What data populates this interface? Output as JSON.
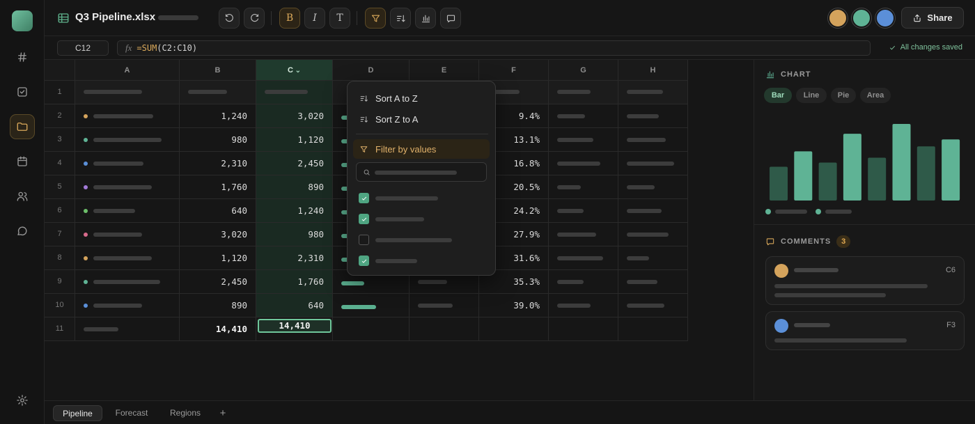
{
  "app": {
    "file_name": "Q3 Pipeline.xlsx",
    "collaborators": [
      {
        "color": "#d4a35c"
      },
      {
        "color": "#5fb395"
      },
      {
        "color": "#5b8fd8"
      }
    ],
    "share_label": "Share",
    "save_status": "All changes saved"
  },
  "formula_bar": {
    "cell_ref": "C12",
    "fx_label": "fx",
    "formula_fn": "=SUM",
    "formula_args": "(C2:C10)"
  },
  "sheet": {
    "columns": [
      "A",
      "B",
      "C",
      "D",
      "E",
      "F",
      "G",
      "H"
    ],
    "selected_column": "C",
    "row_numbers": [
      "1",
      "2",
      "3",
      "4",
      "5",
      "6",
      "7",
      "8",
      "9",
      "10",
      "11"
    ],
    "rows": [
      {
        "dot": "#d4a35c",
        "b": "1,240",
        "c": "3,020",
        "f": "9.4%"
      },
      {
        "dot": "#5fb395",
        "b": "980",
        "c": "1,120",
        "f": "13.1%"
      },
      {
        "dot": "#5b8fd8",
        "b": "2,310",
        "c": "2,450",
        "f": "16.8%"
      },
      {
        "dot": "#a27ad8",
        "b": "1,760",
        "c": "890",
        "f": "20.5%"
      },
      {
        "dot": "#6cbf6a",
        "b": "640",
        "c": "1,240",
        "f": "24.2%"
      },
      {
        "dot": "#d86a8c",
        "b": "3,020",
        "c": "980",
        "f": "27.9%"
      },
      {
        "dot": "#d4a35c",
        "b": "1,120",
        "c": "2,310",
        "f": "31.6%"
      },
      {
        "dot": "#5fb395",
        "b": "2,450",
        "c": "1,760",
        "f": "35.3%"
      },
      {
        "dot": "#5b8fd8",
        "b": "890",
        "c": "640",
        "f": "39.0%"
      }
    ],
    "total_b": "14,410",
    "total_c": "14,410"
  },
  "filter_menu": {
    "sort_az": "Sort A to Z",
    "sort_za": "Sort Z to A",
    "filter_by_values": "Filter by values",
    "options": [
      {
        "checked": true
      },
      {
        "checked": true
      },
      {
        "checked": false
      },
      {
        "checked": true
      }
    ]
  },
  "chart_panel": {
    "title": "CHART",
    "types": [
      "Bar",
      "Line",
      "Pie",
      "Area"
    ],
    "active_type": "Bar",
    "chart_data": {
      "type": "bar",
      "values": [
        48,
        70,
        54,
        95,
        61,
        109,
        77,
        87
      ],
      "colors": [
        "#2f5a49",
        "#5fb395",
        "#2f5a49",
        "#5fb395",
        "#2f5a49",
        "#5fb395",
        "#2f5a49",
        "#5fb395"
      ]
    }
  },
  "comments_panel": {
    "title": "COMMENTS",
    "count": "3",
    "items": [
      {
        "avatar_color": "#d4a35c",
        "cell": "C6"
      },
      {
        "avatar_color": "#5b8fd8",
        "cell": "F3"
      }
    ]
  },
  "sheet_tabs": {
    "tabs": [
      "Pipeline",
      "Forecast",
      "Regions"
    ],
    "active": "Pipeline",
    "add_label": "+"
  }
}
